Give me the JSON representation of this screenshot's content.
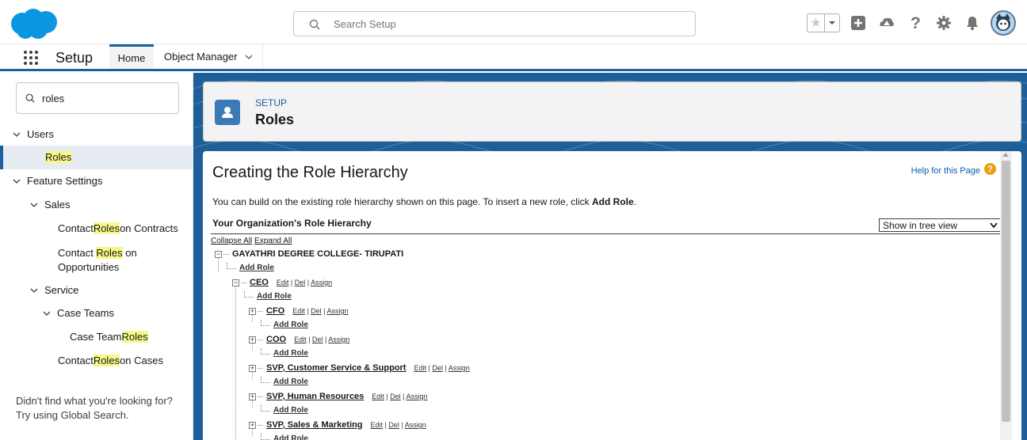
{
  "header": {
    "search_placeholder": "Search Setup"
  },
  "nav": {
    "app_name": "Setup",
    "tabs": [
      {
        "label": "Home"
      },
      {
        "label": "Object Manager"
      }
    ]
  },
  "sidebar": {
    "search_value": "roles",
    "items": {
      "users": "Users",
      "roles": "Roles",
      "feature_settings": "Feature Settings",
      "sales": "Sales",
      "contact_roles_contracts": {
        "pre": "Contact ",
        "hl": "Roles",
        "post": " on Contracts"
      },
      "contact_roles_opps": {
        "pre": "Contact ",
        "hl": "Roles",
        "post": " on",
        "line2": "Opportunities"
      },
      "service": "Service",
      "case_teams": "Case Teams",
      "case_team_roles": {
        "pre": "Case Team ",
        "hl": "Roles"
      },
      "contact_roles_cases": {
        "pre": "Contact ",
        "hl": "Roles",
        "post": " on Cases"
      }
    },
    "footer": "Didn't find what you're looking for? Try using Global Search."
  },
  "page_header": {
    "breadcrumb": "SETUP",
    "title": "Roles"
  },
  "content": {
    "title": "Creating the Role Hierarchy",
    "help_link": "Help for this Page",
    "intro_pre": "You can build on the existing role hierarchy shown on this page. To insert a new role, click ",
    "intro_bold": "Add Role",
    "intro_post": ".",
    "hierarchy_label": "Your Organization's Role Hierarchy",
    "view_select": "Show in tree view",
    "collapse_all": "Collapse All",
    "expand_all": "Expand All",
    "org_name": "GAYATHRI DEGREE COLLEGE- TIRUPATI",
    "add_role": "Add Role",
    "action_edit": "Edit",
    "action_del": "Del",
    "action_assign": "Assign",
    "roles": [
      {
        "name": "CEO"
      },
      {
        "name": "CFO"
      },
      {
        "name": "COO"
      },
      {
        "name": "SVP, Customer Service & Support"
      },
      {
        "name": "SVP, Human Resources"
      },
      {
        "name": "SVP, Sales & Marketing"
      }
    ]
  },
  "colors": {
    "brand": "#1b5f9e",
    "cloud": "#0b96e2",
    "highlight": "#f7f78a"
  }
}
